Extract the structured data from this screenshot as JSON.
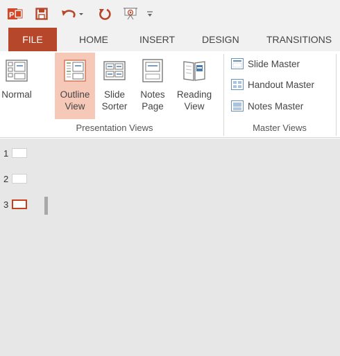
{
  "colors": {
    "accent": "#b7472a",
    "selected_bg": "#f6c8b8",
    "pane_bg": "#e7e7e7",
    "selected_slide_border": "#c4411d"
  },
  "quick_access": {
    "icons": [
      "powerpoint-logo-icon",
      "save-icon",
      "undo-icon",
      "redo-icon",
      "start-from-beginning-icon",
      "customize-qat-icon"
    ]
  },
  "tabs": [
    {
      "label": "FILE"
    },
    {
      "label": "HOME"
    },
    {
      "label": "INSERT"
    },
    {
      "label": "DESIGN"
    },
    {
      "label": "TRANSITIONS"
    }
  ],
  "ribbon": {
    "presentation_views": {
      "label": "Presentation Views",
      "buttons": [
        {
          "label1": "Normal",
          "label2": "",
          "active": false
        },
        {
          "label1": "Outline",
          "label2": "View",
          "active": true
        },
        {
          "label1": "Slide",
          "label2": "Sorter",
          "active": false
        },
        {
          "label1": "Notes",
          "label2": "Page",
          "active": false
        },
        {
          "label1": "Reading",
          "label2": "View",
          "active": false
        }
      ]
    },
    "master_views": {
      "label": "Master Views",
      "items": [
        {
          "label": "Slide Master"
        },
        {
          "label": "Handout Master"
        },
        {
          "label": "Notes Master"
        }
      ]
    }
  },
  "outline": {
    "slides": [
      {
        "number": "1",
        "selected": false
      },
      {
        "number": "2",
        "selected": false
      },
      {
        "number": "3",
        "selected": true
      }
    ]
  }
}
